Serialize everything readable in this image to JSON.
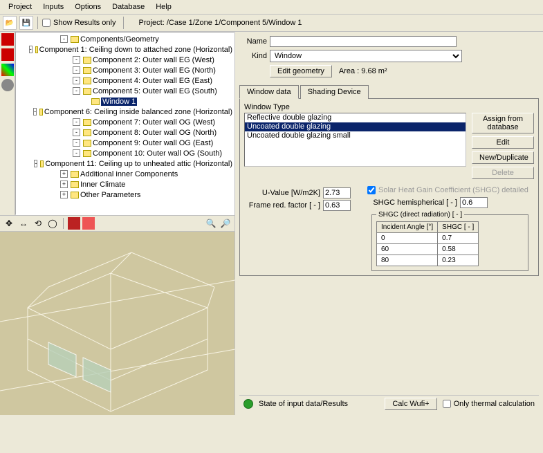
{
  "menu": [
    "Project",
    "Inputs",
    "Options",
    "Database",
    "Help"
  ],
  "toolbar": {
    "show_results": "Show Results only",
    "project_label": "Project:",
    "project_path": "/Case 1/Zone 1/Component 5/Window 1"
  },
  "tree": {
    "root": "Components/Geometry",
    "items": [
      {
        "exp": "-",
        "label": "Component 1: Ceiling down to attached zone (Horizontal)"
      },
      {
        "exp": "-",
        "label": "Component 2: Outer wall EG (West)"
      },
      {
        "exp": "-",
        "label": "Component 3: Outer wall EG (North)"
      },
      {
        "exp": "-",
        "label": "Component 4: Outer wall EG (East)"
      },
      {
        "exp": "-",
        "label": "Component 5: Outer wall EG (South)"
      },
      {
        "exp": "",
        "label": "Window 1",
        "sel": true,
        "extra": 12
      },
      {
        "exp": "-",
        "label": "Component 6: Ceiling inside balanced zone (Horizontal)"
      },
      {
        "exp": "-",
        "label": "Component 7: Outer wall OG (West)"
      },
      {
        "exp": "-",
        "label": "Component 8: Outer wall OG (North)"
      },
      {
        "exp": "-",
        "label": "Component 9: Outer wall OG (East)"
      },
      {
        "exp": "-",
        "label": "Component 10: Outer wall OG (South)"
      },
      {
        "exp": "-",
        "label": "Component 11: Ceiling up to unheated attic (Horizontal)"
      }
    ],
    "extras": [
      "Additional inner Components",
      "Inner Climate",
      "Other Parameters"
    ]
  },
  "props": {
    "name_label": "Name",
    "name_value": "",
    "kind_label": "Kind",
    "kind_value": "Window",
    "edit_geom": "Edit geometry",
    "area_label": "Area :",
    "area_value": "9.68 m²"
  },
  "tabs": {
    "a": "Window data",
    "b": "Shading Device"
  },
  "window_type": {
    "label": "Window Type",
    "options": [
      "Reflective double glazing",
      "Uncoated double glazing",
      "Uncoated double glazing small"
    ],
    "selected": 1
  },
  "side_buttons": {
    "assign": "Assign from database",
    "edit": "Edit",
    "newdup": "New/Duplicate",
    "delete": "Delete"
  },
  "values": {
    "uvalue_label": "U-Value [W/m2K]",
    "uvalue": "2.73",
    "frame_label": "Frame red. factor [ - ]",
    "frame": "0.63",
    "shgc_detailed": "Solar Heat Gain Coefficient (SHGC) detailed",
    "hemi_label": "SHGC hemispherical [ - ]",
    "hemi": "0.6"
  },
  "shgc_table": {
    "legend": "SHGC (direct radiation) [ - ]",
    "h1": "Incident Angle [°]",
    "h2": "SHGC [ - ]",
    "rows": [
      [
        "0",
        "0.7"
      ],
      [
        "60",
        "0.58"
      ],
      [
        "80",
        "0.23"
      ]
    ]
  },
  "status": {
    "state_label": "State of input data/Results",
    "calc": "Calc Wufi+",
    "only_thermal": "Only thermal calculation"
  }
}
